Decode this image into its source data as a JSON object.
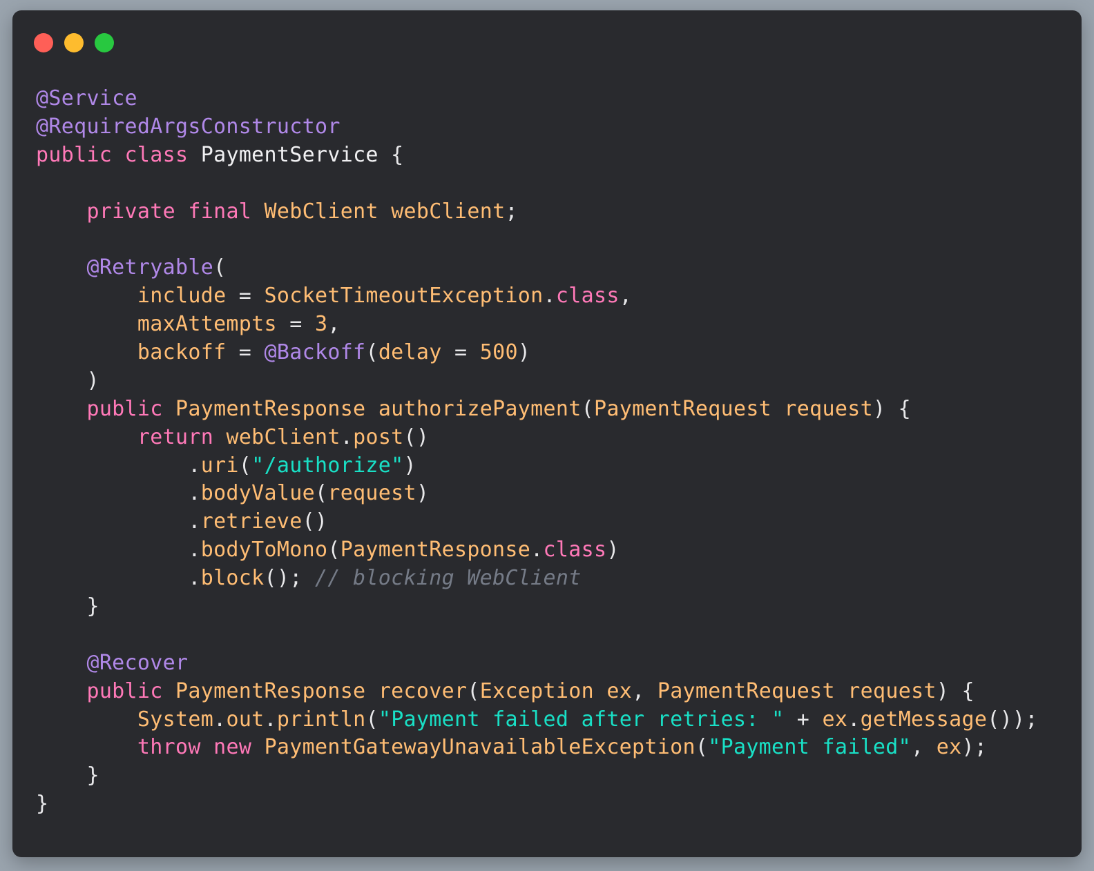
{
  "window": {
    "buttons": {
      "close": "close",
      "minimize": "minimize",
      "zoom": "zoom"
    }
  },
  "colors": {
    "annotation": "#b088e8",
    "keyword": "#ff79b8",
    "type": "#ffbd74",
    "string": "#19e0c6",
    "comment": "#757b87",
    "plain": "#f0f0f2",
    "background": "#292a2e"
  },
  "code": {
    "language": "java",
    "lines": [
      [
        {
          "t": "annot",
          "v": "@Service"
        }
      ],
      [
        {
          "t": "annot",
          "v": "@RequiredArgsConstructor"
        }
      ],
      [
        {
          "t": "kw",
          "v": "public"
        },
        {
          "t": "punct",
          "v": " "
        },
        {
          "t": "kw",
          "v": "class"
        },
        {
          "t": "punct",
          "v": " "
        },
        {
          "t": "plain",
          "v": "PaymentService"
        },
        {
          "t": "punct",
          "v": " {"
        }
      ],
      [],
      [
        {
          "t": "punct",
          "v": "    "
        },
        {
          "t": "kw",
          "v": "private"
        },
        {
          "t": "punct",
          "v": " "
        },
        {
          "t": "kw",
          "v": "final"
        },
        {
          "t": "punct",
          "v": " "
        },
        {
          "t": "type",
          "v": "WebClient"
        },
        {
          "t": "punct",
          "v": " "
        },
        {
          "t": "ident",
          "v": "webClient"
        },
        {
          "t": "punct",
          "v": ";"
        }
      ],
      [],
      [
        {
          "t": "punct",
          "v": "    "
        },
        {
          "t": "annot",
          "v": "@Retryable"
        },
        {
          "t": "punct",
          "v": "("
        }
      ],
      [
        {
          "t": "punct",
          "v": "        "
        },
        {
          "t": "ident",
          "v": "include"
        },
        {
          "t": "punct",
          "v": " = "
        },
        {
          "t": "type",
          "v": "SocketTimeoutException"
        },
        {
          "t": "punct",
          "v": "."
        },
        {
          "t": "kw",
          "v": "class"
        },
        {
          "t": "punct",
          "v": ","
        }
      ],
      [
        {
          "t": "punct",
          "v": "        "
        },
        {
          "t": "ident",
          "v": "maxAttempts"
        },
        {
          "t": "punct",
          "v": " = "
        },
        {
          "t": "num",
          "v": "3"
        },
        {
          "t": "punct",
          "v": ","
        }
      ],
      [
        {
          "t": "punct",
          "v": "        "
        },
        {
          "t": "ident",
          "v": "backoff"
        },
        {
          "t": "punct",
          "v": " = "
        },
        {
          "t": "annot",
          "v": "@Backoff"
        },
        {
          "t": "punct",
          "v": "("
        },
        {
          "t": "ident",
          "v": "delay"
        },
        {
          "t": "punct",
          "v": " = "
        },
        {
          "t": "num",
          "v": "500"
        },
        {
          "t": "punct",
          "v": ")"
        }
      ],
      [
        {
          "t": "punct",
          "v": "    )"
        }
      ],
      [
        {
          "t": "punct",
          "v": "    "
        },
        {
          "t": "kw",
          "v": "public"
        },
        {
          "t": "punct",
          "v": " "
        },
        {
          "t": "type",
          "v": "PaymentResponse"
        },
        {
          "t": "punct",
          "v": " "
        },
        {
          "t": "ident",
          "v": "authorizePayment"
        },
        {
          "t": "punct",
          "v": "("
        },
        {
          "t": "type",
          "v": "PaymentRequest"
        },
        {
          "t": "punct",
          "v": " "
        },
        {
          "t": "ident",
          "v": "request"
        },
        {
          "t": "punct",
          "v": ") {"
        }
      ],
      [
        {
          "t": "punct",
          "v": "        "
        },
        {
          "t": "kw",
          "v": "return"
        },
        {
          "t": "punct",
          "v": " "
        },
        {
          "t": "ident",
          "v": "webClient"
        },
        {
          "t": "punct",
          "v": "."
        },
        {
          "t": "ident",
          "v": "post"
        },
        {
          "t": "punct",
          "v": "()"
        }
      ],
      [
        {
          "t": "punct",
          "v": "            ."
        },
        {
          "t": "ident",
          "v": "uri"
        },
        {
          "t": "punct",
          "v": "("
        },
        {
          "t": "str",
          "v": "\"/authorize\""
        },
        {
          "t": "punct",
          "v": ")"
        }
      ],
      [
        {
          "t": "punct",
          "v": "            ."
        },
        {
          "t": "ident",
          "v": "bodyValue"
        },
        {
          "t": "punct",
          "v": "("
        },
        {
          "t": "ident",
          "v": "request"
        },
        {
          "t": "punct",
          "v": ")"
        }
      ],
      [
        {
          "t": "punct",
          "v": "            ."
        },
        {
          "t": "ident",
          "v": "retrieve"
        },
        {
          "t": "punct",
          "v": "()"
        }
      ],
      [
        {
          "t": "punct",
          "v": "            ."
        },
        {
          "t": "ident",
          "v": "bodyToMono"
        },
        {
          "t": "punct",
          "v": "("
        },
        {
          "t": "type",
          "v": "PaymentResponse"
        },
        {
          "t": "punct",
          "v": "."
        },
        {
          "t": "kw",
          "v": "class"
        },
        {
          "t": "punct",
          "v": ")"
        }
      ],
      [
        {
          "t": "punct",
          "v": "            ."
        },
        {
          "t": "ident",
          "v": "block"
        },
        {
          "t": "punct",
          "v": "(); "
        },
        {
          "t": "comment",
          "v": "// blocking WebClient"
        }
      ],
      [
        {
          "t": "punct",
          "v": "    }"
        }
      ],
      [],
      [
        {
          "t": "punct",
          "v": "    "
        },
        {
          "t": "annot",
          "v": "@Recover"
        }
      ],
      [
        {
          "t": "punct",
          "v": "    "
        },
        {
          "t": "kw",
          "v": "public"
        },
        {
          "t": "punct",
          "v": " "
        },
        {
          "t": "type",
          "v": "PaymentResponse"
        },
        {
          "t": "punct",
          "v": " "
        },
        {
          "t": "ident",
          "v": "recover"
        },
        {
          "t": "punct",
          "v": "("
        },
        {
          "t": "type",
          "v": "Exception"
        },
        {
          "t": "punct",
          "v": " "
        },
        {
          "t": "ident",
          "v": "ex"
        },
        {
          "t": "punct",
          "v": ", "
        },
        {
          "t": "type",
          "v": "PaymentRequest"
        },
        {
          "t": "punct",
          "v": " "
        },
        {
          "t": "ident",
          "v": "request"
        },
        {
          "t": "punct",
          "v": ") {"
        }
      ],
      [
        {
          "t": "punct",
          "v": "        "
        },
        {
          "t": "type",
          "v": "System"
        },
        {
          "t": "punct",
          "v": "."
        },
        {
          "t": "ident",
          "v": "out"
        },
        {
          "t": "punct",
          "v": "."
        },
        {
          "t": "ident",
          "v": "println"
        },
        {
          "t": "punct",
          "v": "("
        },
        {
          "t": "str",
          "v": "\"Payment failed after retries: \""
        },
        {
          "t": "punct",
          "v": " + "
        },
        {
          "t": "ident",
          "v": "ex"
        },
        {
          "t": "punct",
          "v": "."
        },
        {
          "t": "ident",
          "v": "getMessage"
        },
        {
          "t": "punct",
          "v": "());"
        }
      ],
      [
        {
          "t": "punct",
          "v": "        "
        },
        {
          "t": "kw",
          "v": "throw"
        },
        {
          "t": "punct",
          "v": " "
        },
        {
          "t": "kw",
          "v": "new"
        },
        {
          "t": "punct",
          "v": " "
        },
        {
          "t": "type",
          "v": "PaymentGatewayUnavailableException"
        },
        {
          "t": "punct",
          "v": "("
        },
        {
          "t": "str",
          "v": "\"Payment failed\""
        },
        {
          "t": "punct",
          "v": ", "
        },
        {
          "t": "ident",
          "v": "ex"
        },
        {
          "t": "punct",
          "v": ");"
        }
      ],
      [
        {
          "t": "punct",
          "v": "    }"
        }
      ],
      [
        {
          "t": "punct",
          "v": "}"
        }
      ]
    ]
  }
}
